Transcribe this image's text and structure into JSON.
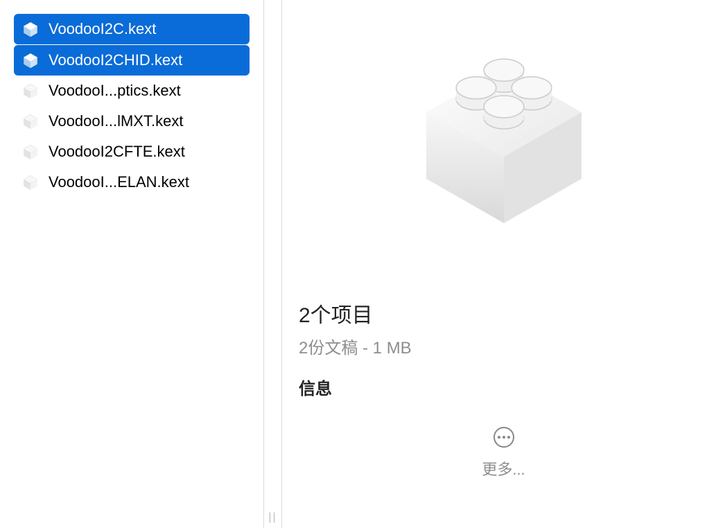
{
  "files": [
    {
      "name": "VoodooI2C.kext",
      "selected": true
    },
    {
      "name": "VoodooI2CHID.kext",
      "selected": true
    },
    {
      "name": "VoodooI...ptics.kext",
      "selected": false
    },
    {
      "name": "VoodooI...lMXT.kext",
      "selected": false
    },
    {
      "name": "VoodooI2CFTE.kext",
      "selected": false
    },
    {
      "name": "VoodooI...ELAN.kext",
      "selected": false
    }
  ],
  "preview": {
    "title": "2个项目",
    "subtitle": "2份文稿 - 1 MB",
    "section": "信息",
    "more_label": "更多..."
  }
}
